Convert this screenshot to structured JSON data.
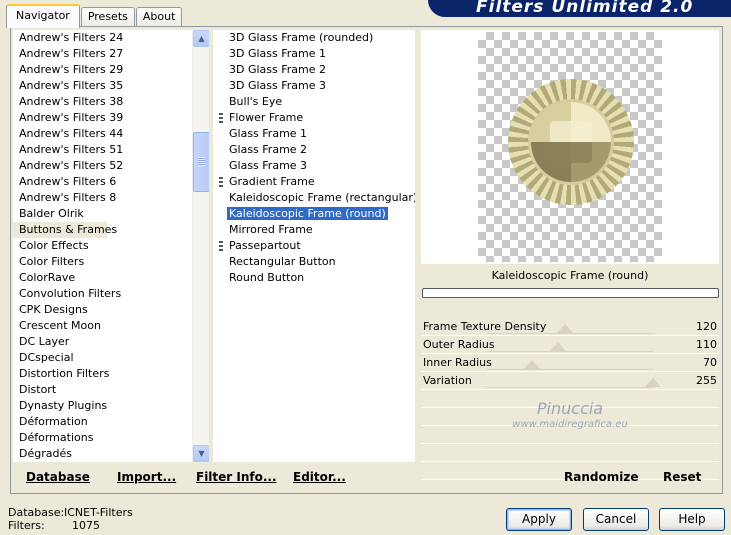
{
  "tabs": [
    "Navigator",
    "Presets",
    "About"
  ],
  "banner": "Filters Unlimited 2.0",
  "categories": [
    "Andrew's Filters 24",
    "Andrew's Filters 27",
    "Andrew's Filters 29",
    "Andrew's Filters 35",
    "Andrew's Filters 38",
    "Andrew's Filters 39",
    "Andrew's Filters 44",
    "Andrew's Filters 51",
    "Andrew's Filters 52",
    "Andrew's Filters 6",
    "Andrew's Filters 8",
    "Balder Olrik",
    "Buttons & Frames",
    "Color Effects",
    "Color Filters",
    "ColorRave",
    "Convolution Filters",
    "CPK Designs",
    "Crescent Moon",
    "DC Layer",
    "DCspecial",
    "Distortion Filters",
    "Distort",
    "Dynasty Plugins",
    "Déformation",
    "Déformations",
    "Dégradés"
  ],
  "selected_category": "Buttons & Frames",
  "filters": [
    {
      "label": "3D Glass Frame (rounded)",
      "group": false
    },
    {
      "label": "3D Glass Frame 1",
      "group": false
    },
    {
      "label": "3D Glass Frame 2",
      "group": false
    },
    {
      "label": "3D Glass Frame 3",
      "group": false
    },
    {
      "label": "Bull's Eye",
      "group": false
    },
    {
      "label": "Flower Frame",
      "group": true
    },
    {
      "label": "Glass Frame 1",
      "group": false
    },
    {
      "label": "Glass Frame 2",
      "group": false
    },
    {
      "label": "Glass Frame 3",
      "group": false
    },
    {
      "label": "Gradient Frame",
      "group": true
    },
    {
      "label": "Kaleidoscopic Frame (rectangular)",
      "group": false
    },
    {
      "label": "Kaleidoscopic Frame (round)",
      "group": false
    },
    {
      "label": "Mirrored Frame",
      "group": false
    },
    {
      "label": "Passepartout",
      "group": true
    },
    {
      "label": "Rectangular Button",
      "group": false
    },
    {
      "label": "Round Button",
      "group": false
    }
  ],
  "selected_filter": "Kaleidoscopic Frame (round)",
  "preview_filter_name": "Kaleidoscopic Frame (round)",
  "sliders": [
    {
      "name": "Frame Texture Density",
      "value": "120",
      "level": 0.47
    },
    {
      "name": "Outer Radius",
      "value": "110",
      "level": 0.43
    },
    {
      "name": "Inner Radius",
      "value": "70",
      "level": 0.27
    },
    {
      "name": "Variation",
      "value": "255",
      "level": 1.0
    }
  ],
  "watermark": {
    "line1": "Pinuccia",
    "line2": "www.maidiregrafica.eu"
  },
  "bottom_left_buttons": {
    "database": "Database",
    "import": "Import...",
    "filter_info": "Filter Info...",
    "editor": "Editor..."
  },
  "bottom_right_buttons": {
    "randomize": "Randomize",
    "reset": "Reset"
  },
  "status": {
    "database_label": "Database:",
    "database_value": "ICNET-Filters",
    "filters_label": "Filters:",
    "filters_value": "1075"
  },
  "dialog_buttons": {
    "apply": "Apply",
    "cancel": "Cancel",
    "help": "Help"
  },
  "colors": {
    "selection": "#316ac5",
    "banner": "#0a246a",
    "dialog_bg": "#ece9d8"
  }
}
